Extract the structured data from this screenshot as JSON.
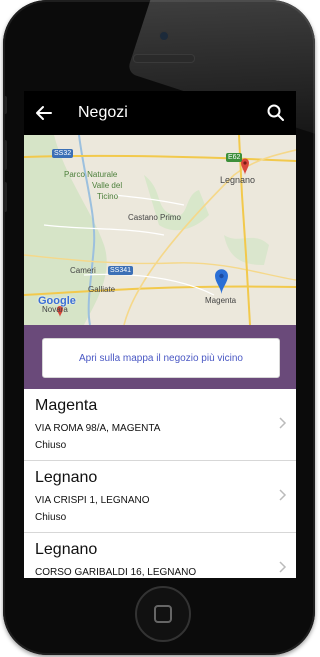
{
  "appbar": {
    "title": "Negozi",
    "back_icon": "arrow-back-icon",
    "search_icon": "search-icon"
  },
  "map": {
    "labels": {
      "parco": "Parco Naturale",
      "valle": "Valle del",
      "ticino": "Ticino",
      "legnano": "Legnano",
      "castano": "Castano Primo",
      "cameri": "Cameri",
      "galliate": "Galliate",
      "magenta": "Magenta",
      "novara": "Novara"
    },
    "roads": {
      "ss32": "SS32",
      "ss341": "SS341",
      "e62": "E62"
    },
    "google": "Google"
  },
  "promo": {
    "button_label": "Apri sulla mappa il negozio più vicino"
  },
  "stores": [
    {
      "name": "Magenta",
      "address": "VIA ROMA 98/A, MAGENTA",
      "status": "Chiuso"
    },
    {
      "name": "Legnano",
      "address": "VIA CRISPI 1, LEGNANO",
      "status": "Chiuso"
    },
    {
      "name": "Legnano",
      "address": "CORSO GARIBALDI 16, LEGNANO",
      "status": ""
    }
  ],
  "colors": {
    "appbar": "#000000",
    "promo": "#6a4a7a",
    "link": "#4a58c4",
    "pin_blue": "#2b6fd6",
    "pin_red": "#d9473b"
  }
}
